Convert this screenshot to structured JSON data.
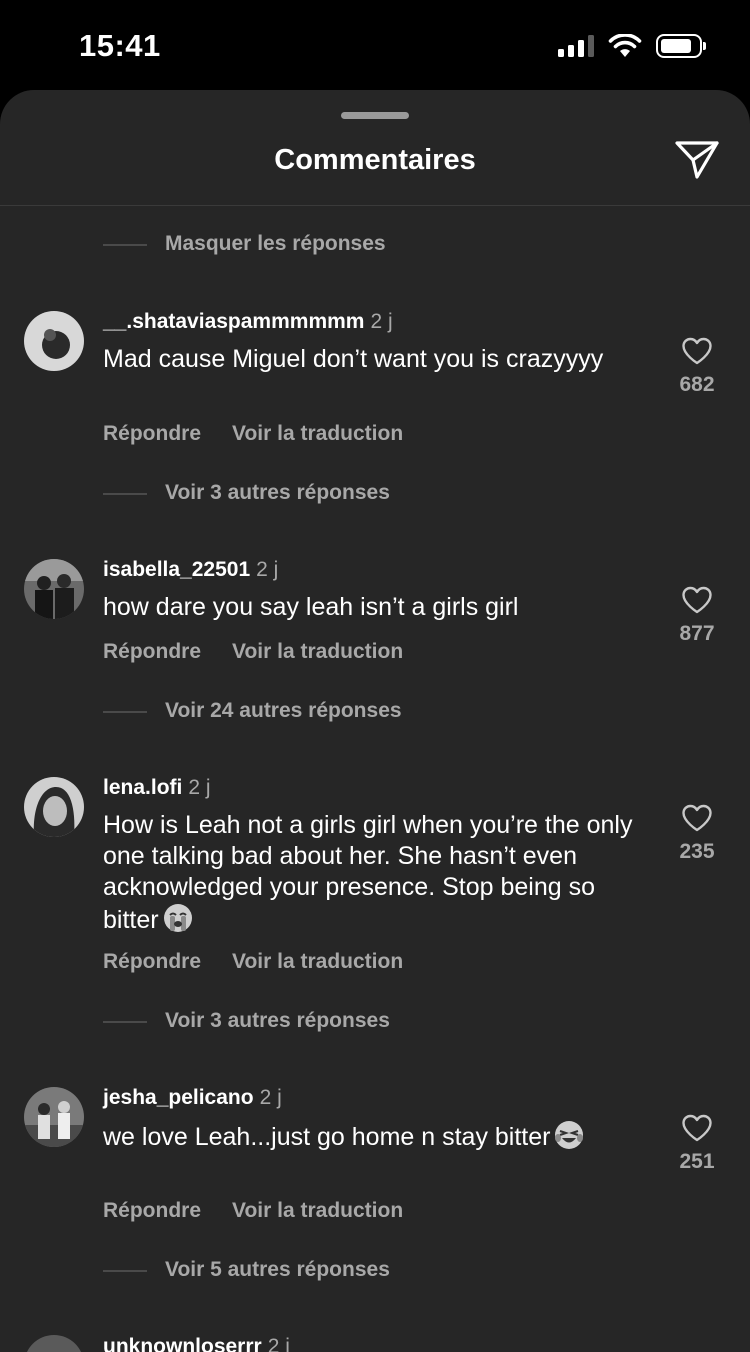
{
  "status": {
    "time": "15:41"
  },
  "sheet": {
    "title": "Commentaires",
    "hide_replies": "Masquer les réponses"
  },
  "actions": {
    "reply": "Répondre",
    "translate": "Voir la traduction"
  },
  "comments": [
    {
      "username": "__.shataviaspammmmmm",
      "time": "2 j",
      "text": "Mad cause Miguel don’t want you is crazyyyy",
      "likes": "682",
      "view_replies": "Voir 3 autres réponses",
      "avatar_icon": "avatar-photo"
    },
    {
      "username": "isabella_22501",
      "time": "2 j",
      "text": "how dare you say leah isn’t a girls girl",
      "likes": "877",
      "view_replies": "Voir 24 autres réponses",
      "avatar_icon": "avatar-photo"
    },
    {
      "username": "lena.lofi",
      "time": "2 j",
      "text": "How is Leah not a girls girl when you’re the only one talking bad about her. She hasn’t even acknowledged your presence. Stop being so bitter",
      "emoji": "crying-face",
      "likes": "235",
      "view_replies": "Voir 3 autres réponses",
      "avatar_icon": "avatar-photo"
    },
    {
      "username": "jesha_pelicano",
      "time": "2 j",
      "text": "we love Leah...just go home n stay bitter",
      "emoji": "laughing-face",
      "likes": "251",
      "view_replies": "Voir 5 autres réponses",
      "avatar_icon": "avatar-photo"
    },
    {
      "username": "unknownloserrr",
      "time": "2 j"
    }
  ],
  "colors": {
    "background": "#000000",
    "sheet": "#262626",
    "secondary_text": "#a8a8a8",
    "primary_text": "#ffffff"
  }
}
